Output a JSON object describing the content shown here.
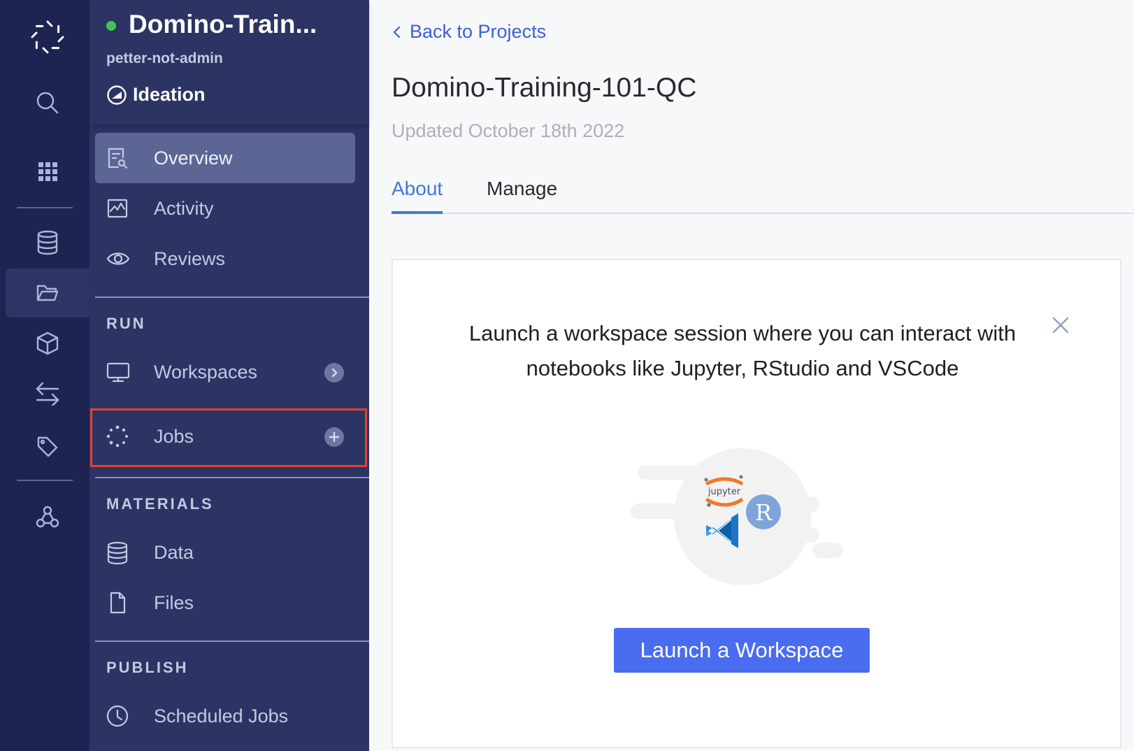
{
  "colors": {
    "rail_bg": "#1e2451",
    "sidebar_bg": "#2c3463",
    "sidebar_active": "#5c6694",
    "accent_blue": "#3d7ad6",
    "link_blue": "#3d5fd9",
    "button_blue": "#4a6cf0",
    "status_green": "#3fc84e",
    "highlight_red": "#e3412f"
  },
  "rail": {
    "icons": [
      "domino-logo-icon",
      "search-icon",
      "apps-grid-icon",
      "data-icon",
      "projects-folder-icon",
      "model-cube-icon",
      "exchange-arrows-icon",
      "tag-icon",
      "network-icon"
    ]
  },
  "project": {
    "name": "Domino-Train...",
    "owner": "petter-not-admin",
    "stage": "Ideation"
  },
  "sidebar": {
    "top_items": [
      {
        "label": "Overview",
        "icon": "overview-icon"
      },
      {
        "label": "Activity",
        "icon": "activity-icon"
      },
      {
        "label": "Reviews",
        "icon": "eye-icon"
      }
    ],
    "run": {
      "title": "RUN",
      "items": [
        {
          "label": "Workspaces",
          "icon": "monitor-icon",
          "action_icon": "chevron-right-icon"
        },
        {
          "label": "Jobs",
          "icon": "jobs-spinner-icon",
          "action_icon": "plus-icon"
        }
      ]
    },
    "materials": {
      "title": "MATERIALS",
      "items": [
        {
          "label": "Data",
          "icon": "database-icon"
        },
        {
          "label": "Files",
          "icon": "file-icon"
        }
      ]
    },
    "publish": {
      "title": "PUBLISH",
      "items": [
        {
          "label": "Scheduled Jobs",
          "icon": "clock-icon"
        }
      ]
    }
  },
  "main": {
    "back_link": "Back to Projects",
    "title": "Domino-Training-101-QC",
    "updated": "Updated October 18th 2022",
    "tabs": [
      {
        "label": "About",
        "active": true
      },
      {
        "label": "Manage",
        "active": false
      }
    ],
    "card": {
      "message": "Launch a workspace session where you can interact with notebooks like Jupyter, RStudio and VSCode",
      "jupyter_label": "jupyter",
      "r_label": "R",
      "button_label": "Launch a Workspace"
    }
  }
}
